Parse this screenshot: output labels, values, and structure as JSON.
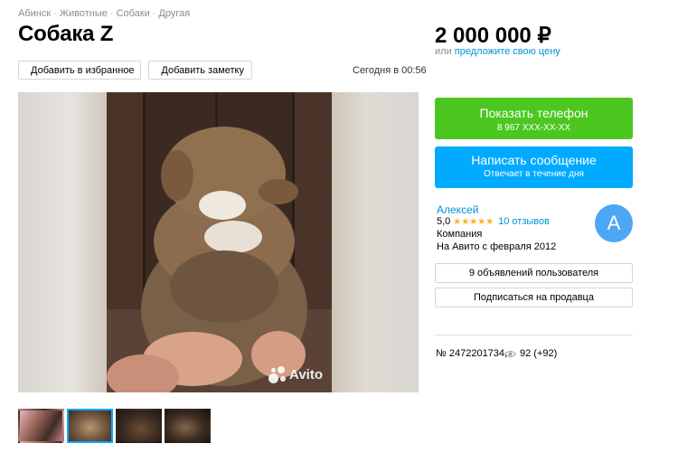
{
  "breadcrumbs": [
    "Абинск",
    "Животные",
    "Собаки",
    "Другая"
  ],
  "title": "Собака Z",
  "price": "2 000 000 ₽",
  "offer": {
    "prefix": "или",
    "link": "предложите свою цену"
  },
  "actions": {
    "favorite": "Добавить в избранное",
    "note": "Добавить заметку"
  },
  "date": "Сегодня в 00:56",
  "watermark": "Avito",
  "contact": {
    "phone_label": "Показать телефон",
    "phone_masked": "8 967 XXX-XX-XX",
    "message_label": "Написать сообщение",
    "message_sub": "Отвечает в течение дня"
  },
  "seller": {
    "name": "Алексей",
    "rating": "5,0",
    "stars": "★★★★★",
    "reviews": "10 отзывов",
    "type": "Компания",
    "since": "На Авито с февраля 2012",
    "avatar_letter": "А"
  },
  "seller_buttons": {
    "ads": "9 объявлений пользователя",
    "subscribe": "Подписаться на продавца"
  },
  "meta": {
    "item_number": "№ 2472201734,",
    "views": "92 (+92)"
  },
  "colors": {
    "green": "#4cc720",
    "blue": "#00aaff",
    "link": "#0091d9",
    "star": "#ffb021"
  },
  "gallery": {
    "thumbnail_count": 4,
    "active_thumbnail": 2
  }
}
